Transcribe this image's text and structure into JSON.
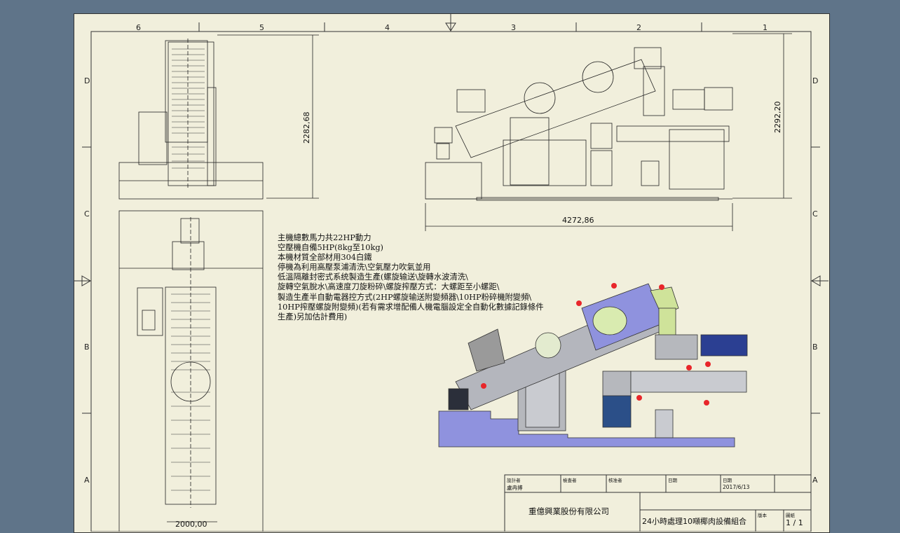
{
  "border": {
    "columns": [
      "6",
      "5",
      "4",
      "3",
      "2",
      "1"
    ],
    "rows": [
      "D",
      "C",
      "B",
      "A"
    ]
  },
  "dimensions": {
    "side_height": "2282,68",
    "front_height": "2292,20",
    "front_length": "4272,86",
    "top_width": "2000,00"
  },
  "notes": [
    "主機總數馬力共22HP動力",
    "空壓機自備5HP(8kg至10kg)",
    "本機材質全部材用304白鐵",
    "停機為利用高壓泵浦清洗\\空氣壓力吹氣並用",
    "低溫隔離封密式系统製造生產(螺旋输送\\旋轉水波清洗\\",
    "旋轉空氣脫水\\高速度刀旋粉碎\\螺旋搾壓方式：大螺距至小螺距\\",
    "製造生產半自動電器控方式(2HP螺旋输送附變頻器\\10HP粉碎機附變頻\\",
    "10HP搾壓螺旋附變頻)(若有需求增配備人機電腦設定全自動化數據記錄條件",
    "生產)另加估計費用)"
  ],
  "title_block": {
    "designer_label": "設計者",
    "designer": "盧冉搏",
    "checker_label": "檢查者",
    "approver_label": "核准者",
    "date_label": "日期",
    "date_label_2": "日期",
    "date": "2017/6/13",
    "company": "重億興業股份有限公司",
    "title": "24小時處理10噸椰肉設備組合",
    "version_label": "版本",
    "sheet_label": "圖紙",
    "sheet": "1 / 1"
  },
  "colors": {
    "paper": "#f1efdc",
    "background": "#5f7489",
    "render_blue": "#8f92de",
    "render_steel": "#b4b6bd",
    "render_green": "#cfe39a"
  }
}
